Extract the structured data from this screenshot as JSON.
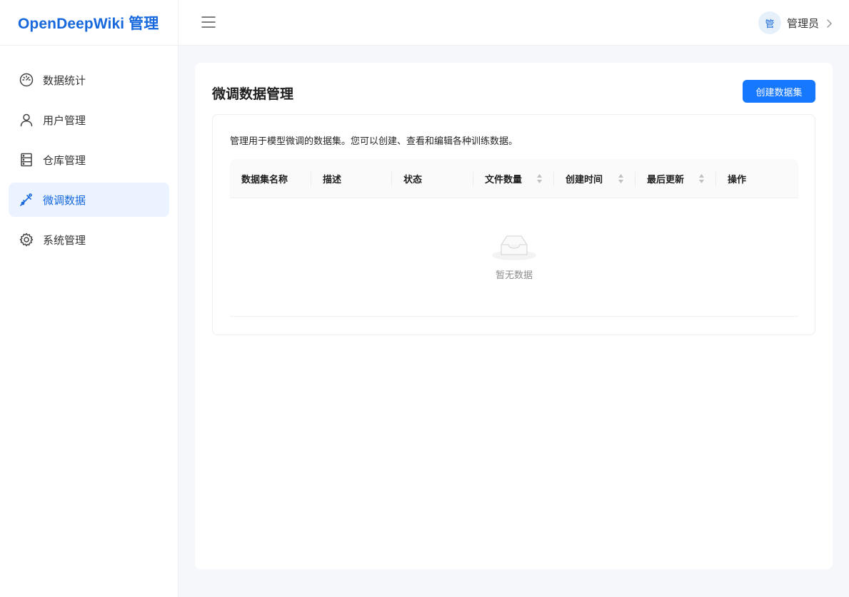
{
  "brand": {
    "title": "OpenDeepWiki 管理"
  },
  "sidebar": {
    "items": [
      {
        "label": "数据统计",
        "icon": "dashboard-icon",
        "active": false
      },
      {
        "label": "用户管理",
        "icon": "user-icon",
        "active": false
      },
      {
        "label": "仓库管理",
        "icon": "database-icon",
        "active": false
      },
      {
        "label": "微调数据",
        "icon": "experiment-icon",
        "active": true
      },
      {
        "label": "系统管理",
        "icon": "gear-icon",
        "active": false
      }
    ]
  },
  "header": {
    "user": {
      "avatar_text": "管",
      "name": "管理员"
    }
  },
  "main": {
    "title": "微调数据管理",
    "create_button": "创建数据集",
    "description": "管理用于模型微调的数据集。您可以创建、查看和编辑各种训练数据。",
    "table": {
      "columns": [
        {
          "label": "数据集名称",
          "sortable": false
        },
        {
          "label": "描述",
          "sortable": false
        },
        {
          "label": "状态",
          "sortable": false
        },
        {
          "label": "文件数量",
          "sortable": true
        },
        {
          "label": "创建时间",
          "sortable": true
        },
        {
          "label": "最后更新",
          "sortable": true
        },
        {
          "label": "操作",
          "sortable": false
        }
      ],
      "rows": [],
      "empty_text": "暂无数据"
    }
  },
  "colors": {
    "primary": "#1677ff",
    "brand_text": "#1668dc",
    "active_bg": "#eaf3ff",
    "page_bg": "#f5f7fb"
  }
}
